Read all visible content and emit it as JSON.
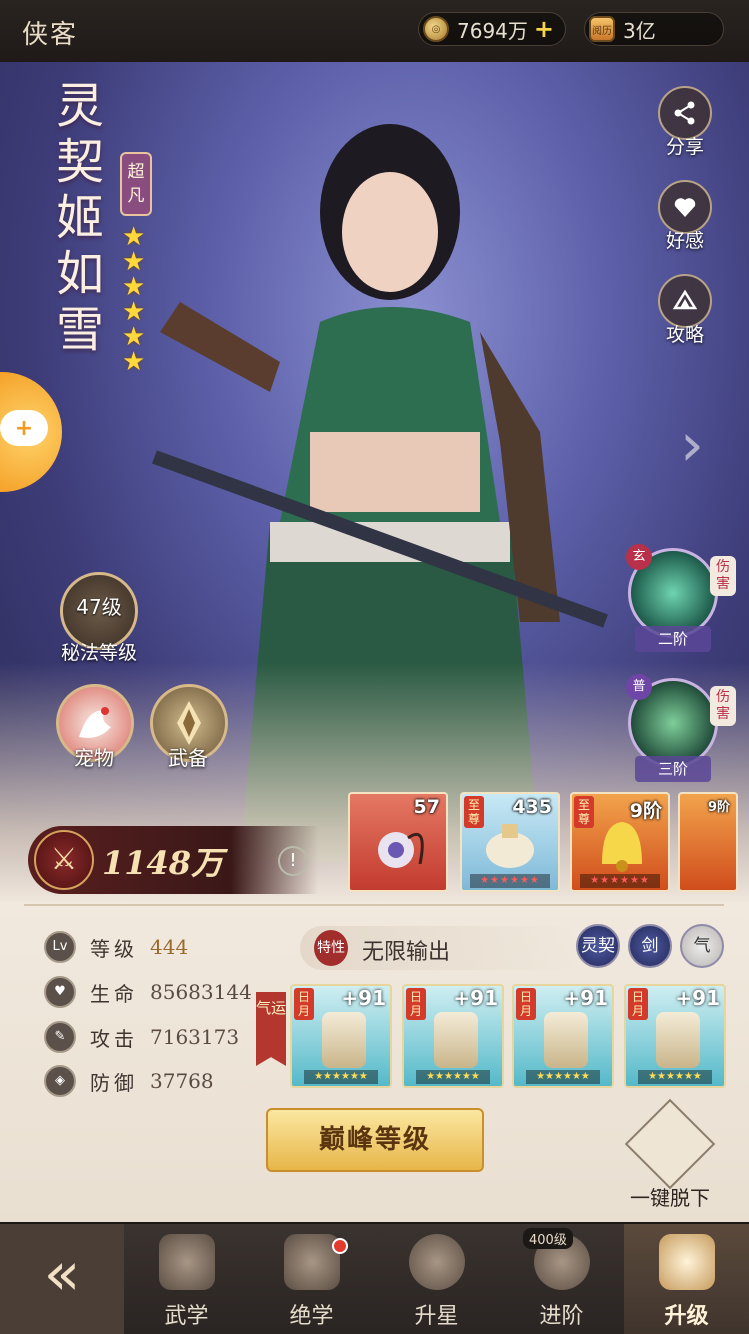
{
  "header": {
    "title": "侠客",
    "coins": "7694万",
    "coin_icon_label": "",
    "gold": "3亿",
    "gold_icon_label": "阅历"
  },
  "hero": {
    "name": "灵契姬如雪",
    "rarity": "超凡",
    "stars": 6,
    "secret_level": "47级",
    "secret_label": "秘法等级",
    "pet_label": "宠物",
    "equip_label": "武备"
  },
  "side_buttons": [
    {
      "label": "分享",
      "icon": "share-icon"
    },
    {
      "label": "好感",
      "icon": "affection-icon"
    },
    {
      "label": "攻略",
      "icon": "guide-icon"
    }
  ],
  "skills": [
    {
      "mark": "玄",
      "side": "伤害",
      "tier": "二阶"
    },
    {
      "mark": "普",
      "side": "伤害",
      "tier": "三阶"
    }
  ],
  "treasures": [
    {
      "count": "57",
      "tag": ""
    },
    {
      "count": "435",
      "tag": "至尊"
    },
    {
      "count": "9阶",
      "tag": "至尊"
    },
    {
      "count": "9阶",
      "tag": ""
    }
  ],
  "power": {
    "value": "1148万",
    "info": "!"
  },
  "stats": [
    {
      "icon": "Lv",
      "name": "等级",
      "value": "444"
    },
    {
      "icon": "♥",
      "name": "生命",
      "value": "85683144"
    },
    {
      "icon": "✎",
      "name": "攻击",
      "value": "7163173"
    },
    {
      "icon": "◈",
      "name": "防御",
      "value": "37768"
    }
  ],
  "style": {
    "badge": "特性",
    "text": "无限输出"
  },
  "schools": [
    "灵契",
    "剑",
    "气"
  ],
  "luck_tag": "气运",
  "gear": [
    {
      "tag": "日月",
      "count": "+91"
    },
    {
      "tag": "日月",
      "count": "+91"
    },
    {
      "tag": "日月",
      "count": "+91"
    },
    {
      "tag": "日月",
      "count": "+91"
    }
  ],
  "peak_button": "巅峰等级",
  "unequip_label": "一键脱下",
  "nav": {
    "back": "«",
    "items": [
      {
        "label": "武学"
      },
      {
        "label": "绝学",
        "dot": true
      },
      {
        "label": "升星"
      },
      {
        "label": "进阶",
        "badge": "400级"
      },
      {
        "label": "升级",
        "active": true
      }
    ]
  },
  "colors": {
    "accent": "#e7b64a",
    "power_bg": "#5a1f1f",
    "hero_bg": "#5c5fa8"
  }
}
